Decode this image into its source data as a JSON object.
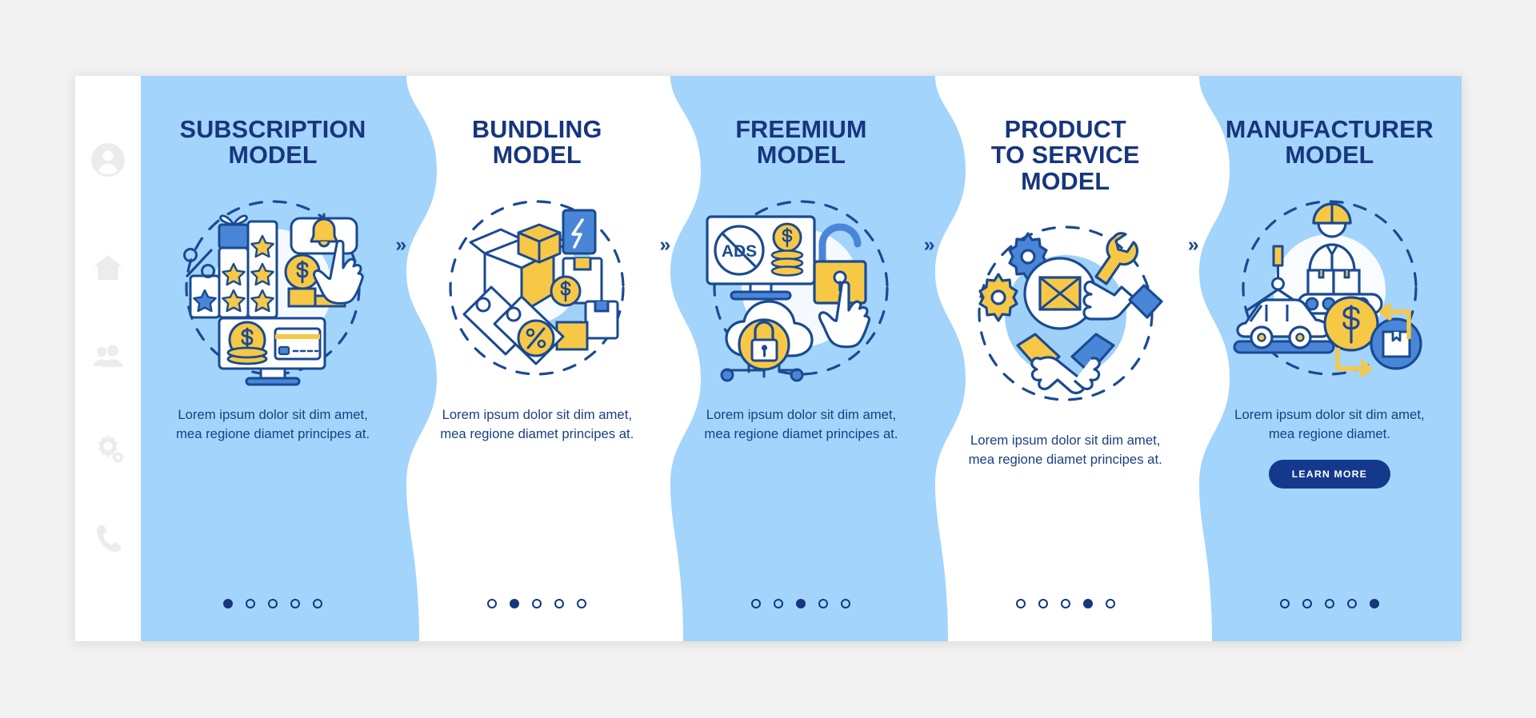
{
  "page": {
    "background_color": "#f2f2f2",
    "card_blue": "#a3d4fb",
    "card_white": "#ffffff",
    "title_color": "#16367d",
    "accent_yellow": "#f6c game",
    "button_color": "#14398c"
  },
  "sidebar": {
    "items": [
      {
        "name": "account-icon",
        "label": "Account"
      },
      {
        "name": "home-icon",
        "label": "Home"
      },
      {
        "name": "people-icon",
        "label": "People"
      },
      {
        "name": "gear-icon",
        "label": "Settings"
      },
      {
        "name": "phone-icon",
        "label": "Contact"
      }
    ]
  },
  "separator": {
    "glyph": "»"
  },
  "cards": [
    {
      "title": "SUBSCRIPTION\nMODEL",
      "body": "Lorem ipsum dolor sit dim amet, mea regione diamet principes at.",
      "theme": "blue",
      "illustration": "subscription-illustration",
      "active_dot": 0,
      "button": null
    },
    {
      "title": "BUNDLING\nMODEL",
      "body": "Lorem ipsum dolor sit dim amet, mea regione diamet principes at.",
      "theme": "white",
      "illustration": "bundling-illustration",
      "active_dot": 1,
      "button": null
    },
    {
      "title": "FREEMIUM\nMODEL",
      "body": "Lorem ipsum dolor sit dim amet, mea regione diamet principes at.",
      "theme": "blue",
      "illustration": "freemium-illustration",
      "active_dot": 2,
      "button": null
    },
    {
      "title": "PRODUCT\nTO SERVICE\nMODEL",
      "body": "Lorem ipsum dolor sit dim amet, mea regione diamet principes at.",
      "theme": "white",
      "illustration": "product-to-service-illustration",
      "active_dot": 3,
      "button": null
    },
    {
      "title": "MANUFACTURER\nMODEL",
      "body": "Lorem ipsum dolor sit dim amet, mea regione diamet.",
      "theme": "blue",
      "illustration": "manufacturer-illustration",
      "active_dot": 4,
      "button": "LEARN MORE"
    }
  ],
  "dots_per_card": 5
}
